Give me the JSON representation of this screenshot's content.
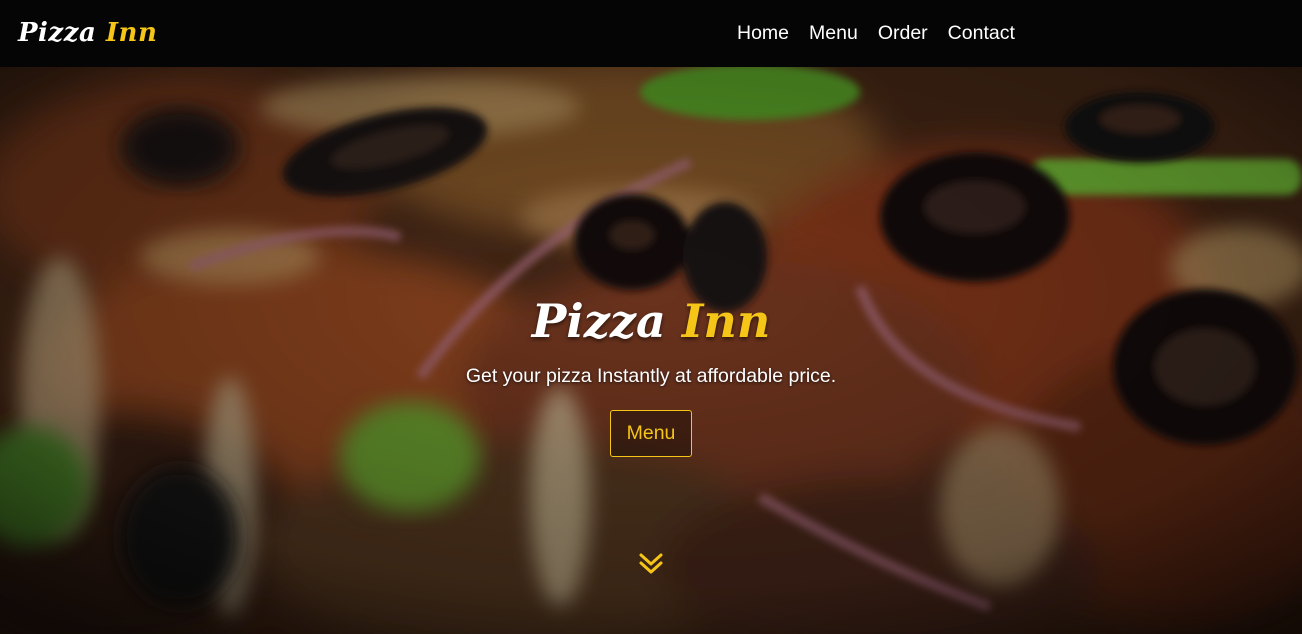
{
  "navbar": {
    "brand_first": "Pizza",
    "brand_second": "Inn",
    "links": [
      "Home",
      "Menu",
      "Order",
      "Contact"
    ]
  },
  "hero": {
    "title_first": "Pizza",
    "title_second": "Inn",
    "subtitle": "Get your pizza Instantly at affordable price.",
    "button_label": "Menu",
    "scroll_icon": "double-chevron-down-icon",
    "background_image": "pizza-closeup-photo"
  },
  "colors": {
    "accent": "#f5c518",
    "navbar_bg": "#050505",
    "text": "#ffffff"
  }
}
